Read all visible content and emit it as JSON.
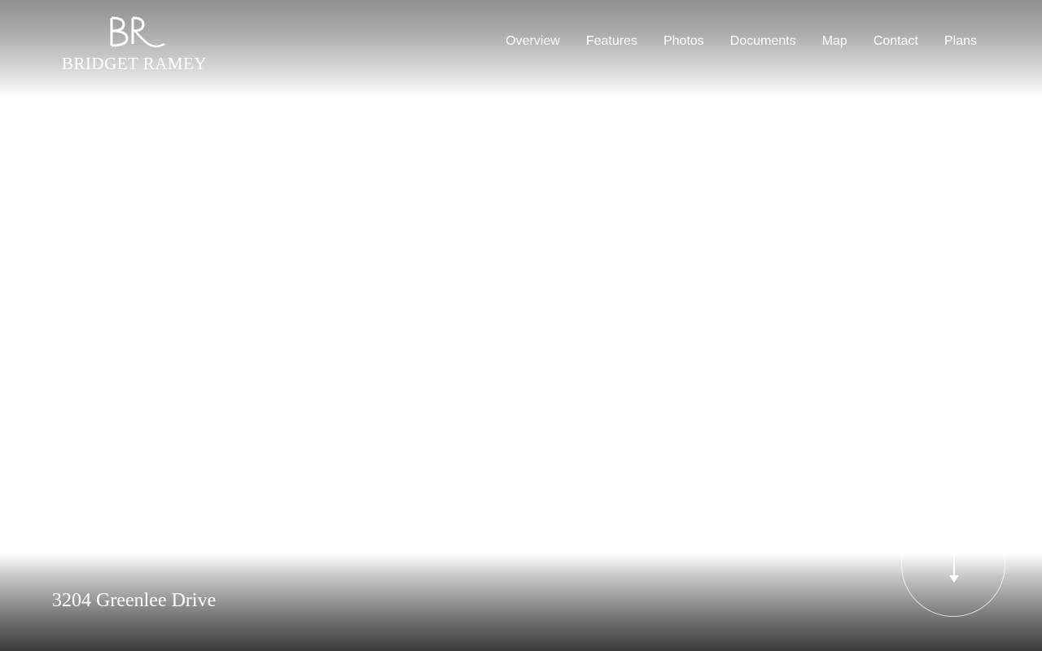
{
  "brand": {
    "monogram": "BR",
    "name": "BRIDGET RAMEY",
    "logo_icon": "br-monogram-logo"
  },
  "nav": {
    "items": [
      {
        "label": "Overview"
      },
      {
        "label": "Features"
      },
      {
        "label": "Photos"
      },
      {
        "label": "Documents"
      },
      {
        "label": "Map"
      },
      {
        "label": "Contact"
      },
      {
        "label": "Plans"
      }
    ]
  },
  "hero": {
    "address": "3204 Greenlee Drive",
    "scroll_icon": "arrow-down-icon"
  },
  "colors": {
    "text": "#ffffff",
    "top_shade": "#909090",
    "bottom_shade": "#3a3a3a"
  }
}
